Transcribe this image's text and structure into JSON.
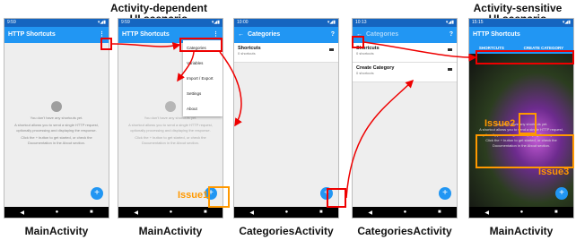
{
  "headings": {
    "left_line1": "Activity-dependent",
    "left_line2": "UI scenario",
    "right_line1": "Activity-sensitive",
    "right_line2": "UI scenario"
  },
  "captions": [
    "MainActivity",
    "MainActivity",
    "CategoriesActivity",
    "CategoriesActivity",
    "MainActivity"
  ],
  "issues": {
    "issue1": "Issue1",
    "issue2": "Issue2",
    "issue3": "Issue3"
  },
  "phones": {
    "p1": {
      "time": "9:59",
      "title": "HTTP Shortcuts"
    },
    "p2": {
      "time": "9:59",
      "title": "HTTP Shortcuts"
    },
    "p3": {
      "time": "10:00",
      "title": "Categories"
    },
    "p4": {
      "time": "10:13",
      "title": "Categories"
    },
    "p5": {
      "time": "15:15",
      "title": "HTTP Shortcuts"
    }
  },
  "empty": {
    "line1": "You don't have any shortcuts yet.",
    "line2": "A shortcut allows you to send a single HTTP request, optionally processing and displaying the response.",
    "line3": "Click the + button to get started, or check the Documentation in the About section."
  },
  "menu": [
    "Categories",
    "Variables",
    "Import / Export",
    "Settings",
    "About"
  ],
  "categories": [
    {
      "name": "Shortcuts",
      "count": "0 shortcuts"
    },
    {
      "name": "Create Category",
      "count": "0 shortcuts"
    }
  ],
  "tabs": {
    "left": "SHORTCUTS",
    "right": "CREATE CATEGORY"
  },
  "icons": {
    "fab": "+",
    "back": "←",
    "help": "?",
    "overflow": "⋮",
    "nav_back": "◀",
    "nav_home": "●",
    "nav_recent": "■"
  },
  "colors": {
    "primary": "#2196f3",
    "highlight": "#e00000",
    "issue": "#ff9800"
  }
}
